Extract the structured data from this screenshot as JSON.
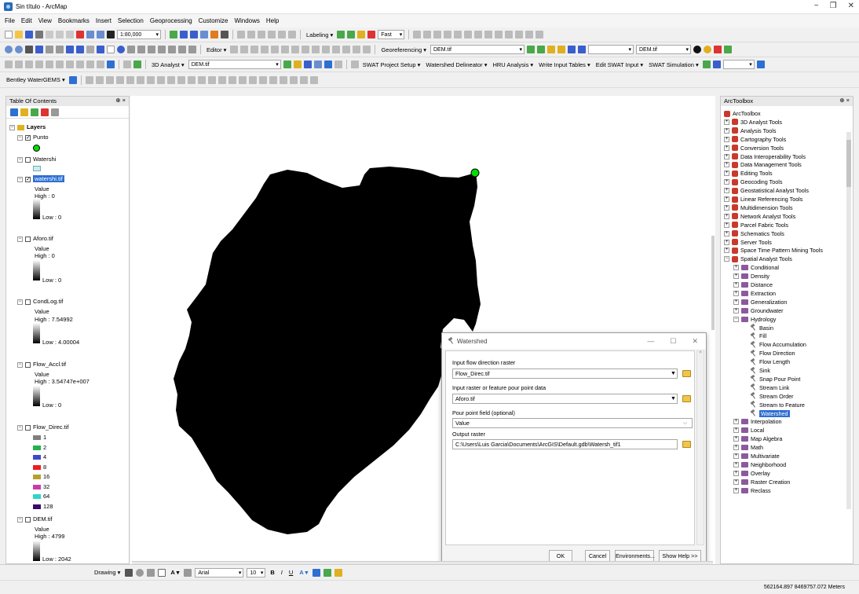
{
  "window": {
    "title": "Sin título - ArcMap"
  },
  "menu": [
    "File",
    "Edit",
    "View",
    "Bookmarks",
    "Insert",
    "Selection",
    "Geoprocessing",
    "Customize",
    "Windows",
    "Help"
  ],
  "toolbars": {
    "scale": "1:80,000",
    "labeling": "Labeling ▾",
    "fast": "Fast",
    "editor": "Editor ▾",
    "georeferencing": "Georeferencing ▾",
    "georef_layer": "DEM.tif",
    "layer_combo_right": "DEM.tif",
    "analyst_3d": "3D Analyst ▾",
    "analyst_layer": "DEM.tif",
    "swat": [
      "SWAT Project Setup ▾",
      "Watershed Delineator ▾",
      "HRU Analysis ▾",
      "Write Input Tables ▾",
      "Edit SWAT Input ▾",
      "SWAT Simulation ▾"
    ],
    "bentley": "Bentley WaterGEMS ▾"
  },
  "toc": {
    "title": "Table Of Contents",
    "pin": "⊕ ×",
    "layers_group": "Layers",
    "layers": [
      {
        "name": "Punto",
        "checked": true
      },
      {
        "name": "Watershi",
        "checked": false
      },
      {
        "name": "watershi.tif",
        "checked": true,
        "value_label": "Value",
        "high": "High : 0",
        "low": "Low : 0"
      },
      {
        "name": "Aforo.tif",
        "checked": false,
        "value_label": "Value",
        "high": "High : 0",
        "low": "Low : 0"
      },
      {
        "name": "CondLog.tif",
        "checked": false,
        "value_label": "Value",
        "high": "High : 7.54992",
        "low": "Low : 4.00004"
      },
      {
        "name": "Flow_Accl.tif",
        "checked": false,
        "value_label": "Value",
        "high": "High : 3.54747e+007",
        "low": "Low : 0"
      },
      {
        "name": "Flow_Direc.tif",
        "checked": false,
        "classes": [
          "1",
          "2",
          "4",
          "8",
          "16",
          "32",
          "64",
          "128"
        ],
        "colors": [
          "#7f7f7f",
          "#22b14c",
          "#3f48cc",
          "#ed1c24",
          "#b5a030",
          "#c93ca8",
          "#2fd6c4",
          "#3a0a66"
        ]
      },
      {
        "name": "DEM.tif",
        "checked": false,
        "value_label": "Value",
        "high": "High : 4799",
        "low": "Low : 2042"
      }
    ]
  },
  "toolbox": {
    "title": "ArcToolbox",
    "pin": "⊕ ×",
    "root": "ArcToolbox",
    "items": [
      "3D Analyst Tools",
      "Analysis Tools",
      "Cartography Tools",
      "Conversion Tools",
      "Data Interoperability Tools",
      "Data Management Tools",
      "Editing Tools",
      "Geocoding Tools",
      "Geostatistical Analyst Tools",
      "Linear Referencing Tools",
      "Multidimension Tools",
      "Network Analyst Tools",
      "Parcel Fabric Tools",
      "Schematics Tools",
      "Server Tools",
      "Space Time Pattern Mining Tools",
      "Spatial Analyst Tools"
    ],
    "spatial_sub_before": [
      "Conditional",
      "Density",
      "Distance",
      "Extraction",
      "Generalization",
      "Groundwater",
      "Hydrology"
    ],
    "hydrology_tools": [
      "Basin",
      "Fill",
      "Flow Accumulation",
      "Flow Direction",
      "Flow Length",
      "Sink",
      "Snap Pour Point",
      "Stream Link",
      "Stream Order",
      "Stream to Feature",
      "Watershed"
    ],
    "spatial_sub_after": [
      "Interpolation",
      "Local",
      "Map Algebra",
      "Math",
      "Multivariate",
      "Neighborhood",
      "Overlay",
      "Raster Creation",
      "Reclass"
    ]
  },
  "dialog": {
    "title": "Watershed",
    "controls": [
      "—",
      "☐",
      "✕"
    ],
    "label1": "Input flow direction raster",
    "value1": "Flow_Direc.tif",
    "label2": "Input raster or feature pour point data",
    "value2": "Aforo.tif",
    "label3": "Pour point field (optional)",
    "value3": "Value",
    "label4": "Output raster",
    "value4": "C:\\Users\\Luis Garcia\\Documents\\ArcGIS\\Default.gdb\\Watersh_tif1",
    "buttons": {
      "ok": "OK",
      "cancel": "Cancel",
      "env": "Environments...",
      "help": "Show Help >>"
    }
  },
  "drawing": {
    "label": "Drawing ▾",
    "font": "Arial",
    "size": "10"
  },
  "status": {
    "coords": "562164.897  8469757.072 Meters"
  },
  "colors": {
    "accent": "#2e6fd2",
    "point": "#00e000"
  }
}
